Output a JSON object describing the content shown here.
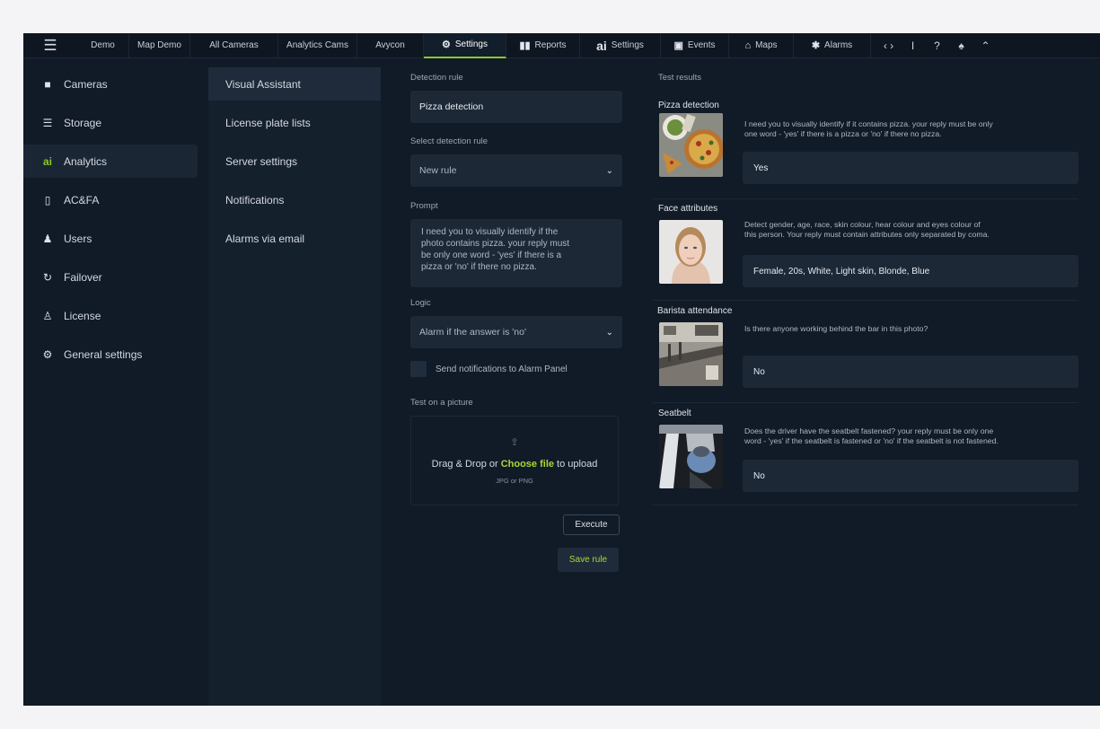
{
  "topbar": {
    "tabs": [
      {
        "label": "Demo",
        "icon": "",
        "active": false
      },
      {
        "label": "Map Demo",
        "icon": "",
        "active": false
      },
      {
        "label": "All Cameras",
        "icon": "",
        "active": false
      },
      {
        "label": "Analytics Cams",
        "icon": "",
        "active": false
      },
      {
        "label": "Avycon",
        "icon": "",
        "active": false
      },
      {
        "label": "Settings",
        "icon": "gear-icon",
        "active": true
      },
      {
        "label": "Reports",
        "icon": "bar-chart-icon",
        "active": false
      },
      {
        "label": "Settings",
        "icon": "ai-icon",
        "active": false
      },
      {
        "label": "Events",
        "icon": "calendar-icon",
        "active": false
      },
      {
        "label": "Maps",
        "icon": "map-pin-icon",
        "active": false
      },
      {
        "label": "Alarms",
        "icon": "siren-icon",
        "active": false
      }
    ],
    "ai_badge": "ai",
    "right_icons": [
      "code-icon",
      "text-cursor-icon",
      "help-icon",
      "bell-icon",
      "chevron-up-icon"
    ]
  },
  "sidebar": {
    "items": [
      {
        "label": "Cameras",
        "icon": "camera-icon",
        "active": false
      },
      {
        "label": "Storage",
        "icon": "database-icon",
        "active": false
      },
      {
        "label": "Analytics",
        "icon": "ai-icon",
        "active": true
      },
      {
        "label": "AC&FA",
        "icon": "door-icon",
        "active": false
      },
      {
        "label": "Users",
        "icon": "user-icon",
        "active": false
      },
      {
        "label": "Failover",
        "icon": "failover-icon",
        "active": false
      },
      {
        "label": "License",
        "icon": "license-icon",
        "active": false
      },
      {
        "label": "General settings",
        "icon": "gear-icon",
        "active": false
      }
    ],
    "analytics_glyph": "ai"
  },
  "subnav": {
    "items": [
      {
        "label": "Visual Assistant",
        "active": true
      },
      {
        "label": "License plate lists",
        "active": false
      },
      {
        "label": "Server settings",
        "active": false
      },
      {
        "label": "Notifications",
        "active": false
      },
      {
        "label": "Alarms via email",
        "active": false
      }
    ]
  },
  "form": {
    "detection_rule_label": "Detection rule",
    "detection_rule_value": "Pizza detection",
    "select_rule_label": "Select detection rule",
    "select_rule_value": "New rule",
    "prompt_label": "Prompt",
    "prompt_lines": [
      "I need you to visually identify if the",
      "photo contains pizza. your reply must",
      "be only one word - 'yes' if there is a",
      "pizza or 'no' if there no pizza."
    ],
    "logic_label": "Logic",
    "logic_value": "Alarm if the answer is 'no'",
    "send_notifications_label": "Send notifications to Alarm Panel",
    "send_notifications_checked": false,
    "test_label": "Test on a picture",
    "dropzone": {
      "prefix": "Drag & Drop or ",
      "link": "Choose file",
      "suffix": " to upload",
      "formats": "JPG or PNG"
    },
    "execute_label": "Execute",
    "save_label": "Save rule"
  },
  "results": {
    "title": "Test results",
    "items": [
      {
        "name": "Pizza detection",
        "prompt_lines": [
          "I need you to visually identify if it contains pizza. your reply must  be only",
          "one word - 'yes' if there is a pizza or 'no' if there no pizza."
        ],
        "answer": "Yes",
        "thumb": "pizza-photo"
      },
      {
        "name": "Face attributes",
        "prompt_lines": [
          "Detect gender, age, race, skin colour, hear colour and eyes colour of",
          "this person. Your reply must contain attributes only separated by coma."
        ],
        "answer": "Female, 20s, White, Light skin, Blonde, Blue",
        "thumb": "face-photo"
      },
      {
        "name": "Barista attendance",
        "prompt_lines": [
          "Is there anyone working behind the bar in this photo?"
        ],
        "answer": "No",
        "thumb": "bar-photo"
      },
      {
        "name": "Seatbelt",
        "prompt_lines": [
          "Does the driver have the seatbelt fastened? your reply must be only one",
          "word - 'yes' if the seatbelt is fastened or 'no' if the seatbelt is not fastened."
        ],
        "answer": "No",
        "thumb": "car-interior-photo"
      }
    ]
  },
  "colors": {
    "accent": "#8ac926",
    "background": "#111a27",
    "panel": "#15202d",
    "field": "#1c2836"
  }
}
